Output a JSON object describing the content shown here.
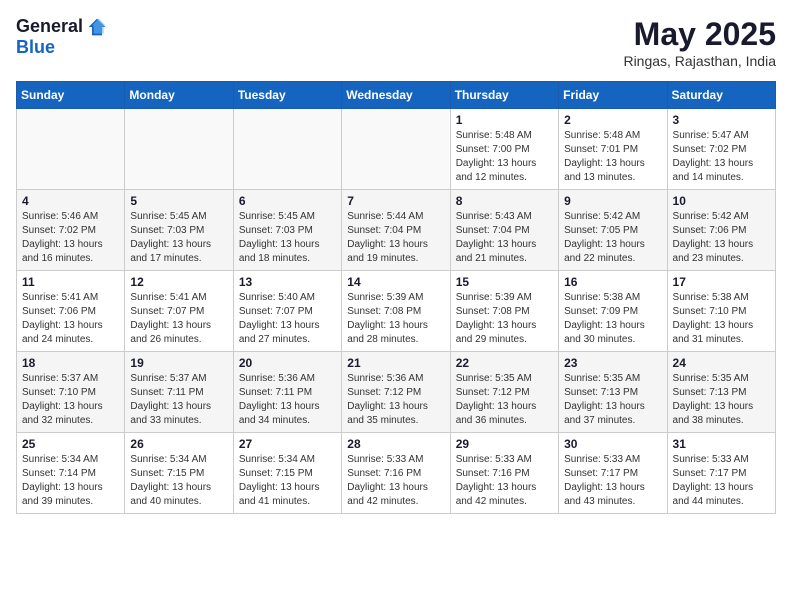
{
  "logo": {
    "general": "General",
    "blue": "Blue"
  },
  "title": {
    "month": "May 2025",
    "location": "Ringas, Rajasthan, India"
  },
  "days_of_week": [
    "Sunday",
    "Monday",
    "Tuesday",
    "Wednesday",
    "Thursday",
    "Friday",
    "Saturday"
  ],
  "weeks": [
    [
      {
        "day": "",
        "info": ""
      },
      {
        "day": "",
        "info": ""
      },
      {
        "day": "",
        "info": ""
      },
      {
        "day": "",
        "info": ""
      },
      {
        "day": "1",
        "info": "Sunrise: 5:48 AM\nSunset: 7:00 PM\nDaylight: 13 hours\nand 12 minutes."
      },
      {
        "day": "2",
        "info": "Sunrise: 5:48 AM\nSunset: 7:01 PM\nDaylight: 13 hours\nand 13 minutes."
      },
      {
        "day": "3",
        "info": "Sunrise: 5:47 AM\nSunset: 7:02 PM\nDaylight: 13 hours\nand 14 minutes."
      }
    ],
    [
      {
        "day": "4",
        "info": "Sunrise: 5:46 AM\nSunset: 7:02 PM\nDaylight: 13 hours\nand 16 minutes."
      },
      {
        "day": "5",
        "info": "Sunrise: 5:45 AM\nSunset: 7:03 PM\nDaylight: 13 hours\nand 17 minutes."
      },
      {
        "day": "6",
        "info": "Sunrise: 5:45 AM\nSunset: 7:03 PM\nDaylight: 13 hours\nand 18 minutes."
      },
      {
        "day": "7",
        "info": "Sunrise: 5:44 AM\nSunset: 7:04 PM\nDaylight: 13 hours\nand 19 minutes."
      },
      {
        "day": "8",
        "info": "Sunrise: 5:43 AM\nSunset: 7:04 PM\nDaylight: 13 hours\nand 21 minutes."
      },
      {
        "day": "9",
        "info": "Sunrise: 5:42 AM\nSunset: 7:05 PM\nDaylight: 13 hours\nand 22 minutes."
      },
      {
        "day": "10",
        "info": "Sunrise: 5:42 AM\nSunset: 7:06 PM\nDaylight: 13 hours\nand 23 minutes."
      }
    ],
    [
      {
        "day": "11",
        "info": "Sunrise: 5:41 AM\nSunset: 7:06 PM\nDaylight: 13 hours\nand 24 minutes."
      },
      {
        "day": "12",
        "info": "Sunrise: 5:41 AM\nSunset: 7:07 PM\nDaylight: 13 hours\nand 26 minutes."
      },
      {
        "day": "13",
        "info": "Sunrise: 5:40 AM\nSunset: 7:07 PM\nDaylight: 13 hours\nand 27 minutes."
      },
      {
        "day": "14",
        "info": "Sunrise: 5:39 AM\nSunset: 7:08 PM\nDaylight: 13 hours\nand 28 minutes."
      },
      {
        "day": "15",
        "info": "Sunrise: 5:39 AM\nSunset: 7:08 PM\nDaylight: 13 hours\nand 29 minutes."
      },
      {
        "day": "16",
        "info": "Sunrise: 5:38 AM\nSunset: 7:09 PM\nDaylight: 13 hours\nand 30 minutes."
      },
      {
        "day": "17",
        "info": "Sunrise: 5:38 AM\nSunset: 7:10 PM\nDaylight: 13 hours\nand 31 minutes."
      }
    ],
    [
      {
        "day": "18",
        "info": "Sunrise: 5:37 AM\nSunset: 7:10 PM\nDaylight: 13 hours\nand 32 minutes."
      },
      {
        "day": "19",
        "info": "Sunrise: 5:37 AM\nSunset: 7:11 PM\nDaylight: 13 hours\nand 33 minutes."
      },
      {
        "day": "20",
        "info": "Sunrise: 5:36 AM\nSunset: 7:11 PM\nDaylight: 13 hours\nand 34 minutes."
      },
      {
        "day": "21",
        "info": "Sunrise: 5:36 AM\nSunset: 7:12 PM\nDaylight: 13 hours\nand 35 minutes."
      },
      {
        "day": "22",
        "info": "Sunrise: 5:35 AM\nSunset: 7:12 PM\nDaylight: 13 hours\nand 36 minutes."
      },
      {
        "day": "23",
        "info": "Sunrise: 5:35 AM\nSunset: 7:13 PM\nDaylight: 13 hours\nand 37 minutes."
      },
      {
        "day": "24",
        "info": "Sunrise: 5:35 AM\nSunset: 7:13 PM\nDaylight: 13 hours\nand 38 minutes."
      }
    ],
    [
      {
        "day": "25",
        "info": "Sunrise: 5:34 AM\nSunset: 7:14 PM\nDaylight: 13 hours\nand 39 minutes."
      },
      {
        "day": "26",
        "info": "Sunrise: 5:34 AM\nSunset: 7:15 PM\nDaylight: 13 hours\nand 40 minutes."
      },
      {
        "day": "27",
        "info": "Sunrise: 5:34 AM\nSunset: 7:15 PM\nDaylight: 13 hours\nand 41 minutes."
      },
      {
        "day": "28",
        "info": "Sunrise: 5:33 AM\nSunset: 7:16 PM\nDaylight: 13 hours\nand 42 minutes."
      },
      {
        "day": "29",
        "info": "Sunrise: 5:33 AM\nSunset: 7:16 PM\nDaylight: 13 hours\nand 42 minutes."
      },
      {
        "day": "30",
        "info": "Sunrise: 5:33 AM\nSunset: 7:17 PM\nDaylight: 13 hours\nand 43 minutes."
      },
      {
        "day": "31",
        "info": "Sunrise: 5:33 AM\nSunset: 7:17 PM\nDaylight: 13 hours\nand 44 minutes."
      }
    ]
  ]
}
